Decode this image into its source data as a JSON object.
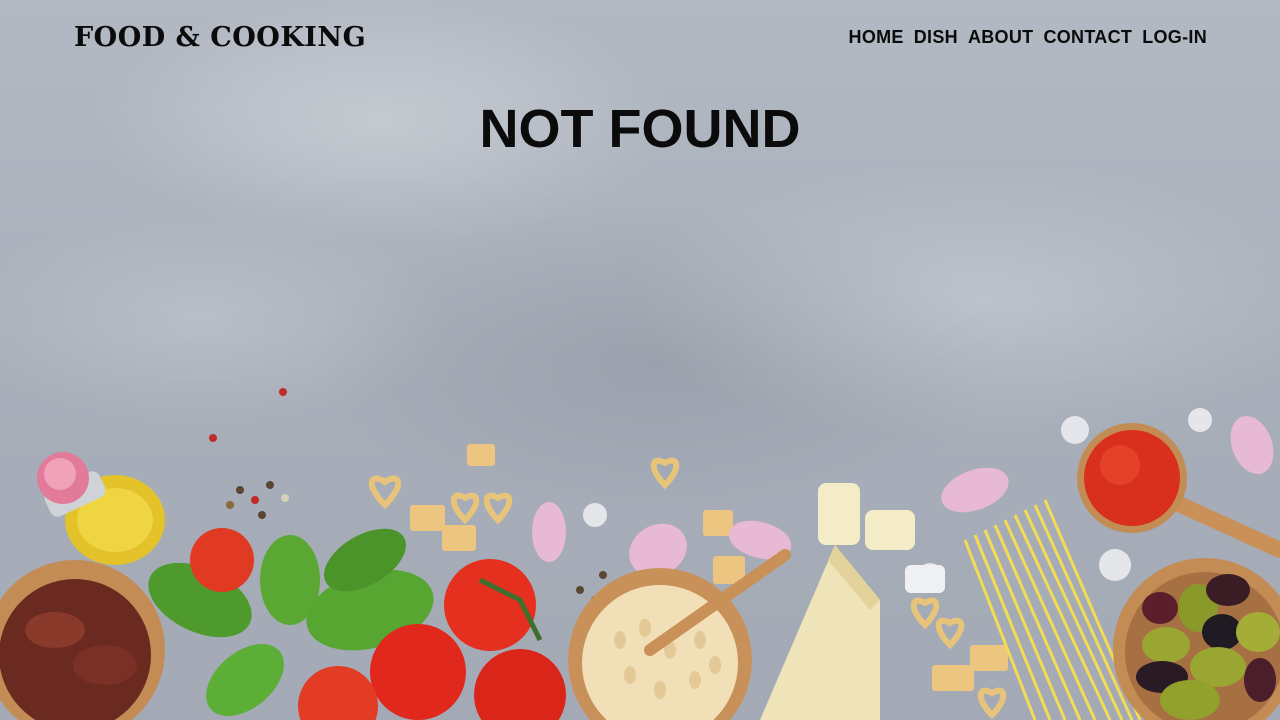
{
  "header": {
    "logo": "FOOD & COOKING",
    "nav": [
      {
        "label": "HOME"
      },
      {
        "label": "DISH"
      },
      {
        "label": "ABOUT"
      },
      {
        "label": "CONTACT"
      },
      {
        "label": "LOG-IN"
      }
    ]
  },
  "main": {
    "title": "NOT FOUND"
  },
  "background": {
    "image": "food-ingredients-on-grey-stone-table",
    "items": [
      "olive oil bottle",
      "sun-dried tomatoes",
      "basil",
      "tomatoes",
      "peppercorns",
      "heart pasta",
      "garlic",
      "pine nuts",
      "parmesan",
      "spaghetti",
      "tomato sauce",
      "olives"
    ]
  }
}
